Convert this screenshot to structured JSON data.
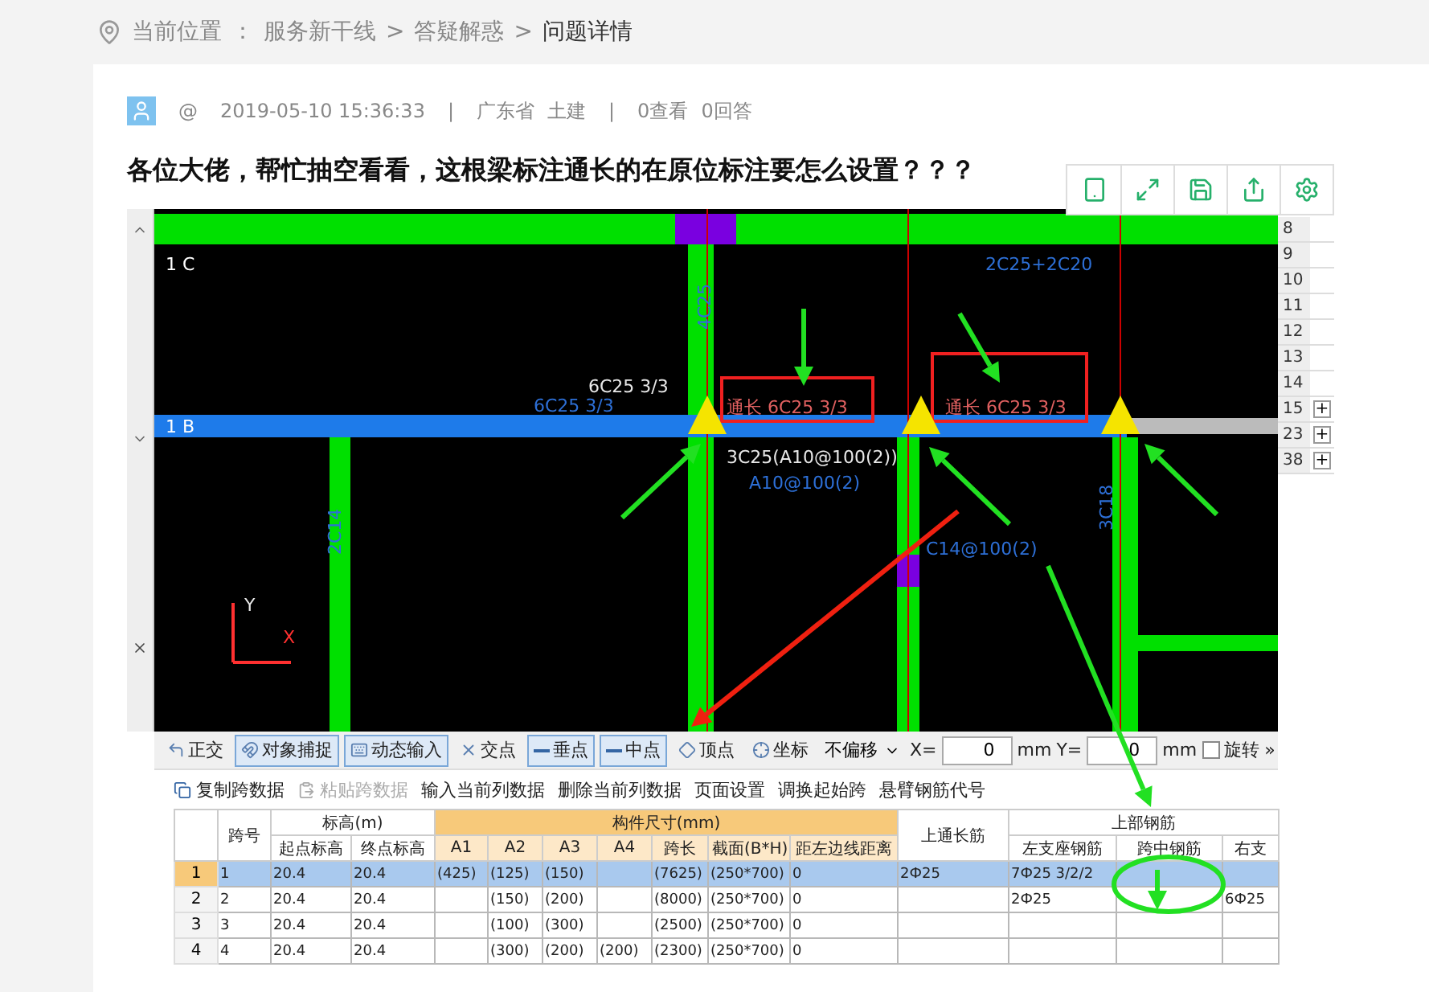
{
  "breadcrumb": {
    "label": "当前位置",
    "colon": "：",
    "path": [
      {
        "text": "服务新干线",
        "current": false
      },
      {
        "text": ">",
        "current": false
      },
      {
        "text": "答疑解惑",
        "current": false
      },
      {
        "text": ">",
        "current": false
      },
      {
        "text": "问题详情",
        "current": true
      }
    ]
  },
  "question": {
    "user": "@",
    "time": "2019-05-10 15:36:33",
    "sep_1": "|",
    "region": "广东省",
    "category": "土建",
    "sep_2": "|",
    "views": "0查看",
    "answers": "0回答",
    "title": "各位大佬，帮忙抽空看看，这根梁标注通长的在原位标注要怎么设置？？？"
  },
  "cad": {
    "labels": [
      {
        "text": "1 C",
        "kind": "axis"
      },
      {
        "text": "1 B",
        "kind": "axis"
      },
      {
        "text": "4C25",
        "kind": "rebar"
      },
      {
        "text": "2C14",
        "kind": "rebar"
      },
      {
        "text": "6C25 3/3",
        "kind": "rebar"
      },
      {
        "text": "6C25 3/3",
        "kind": "note"
      },
      {
        "text": "通长 6C25 3/3",
        "kind": "through"
      },
      {
        "text": "通长 6C25 3/3",
        "kind": "through"
      },
      {
        "text": "3C25(A10@100(2))",
        "kind": "note"
      },
      {
        "text": "A10@100(2)",
        "kind": "rebar"
      },
      {
        "text": "2C25+2C20",
        "kind": "rebar"
      },
      {
        "text": "C14@100(2)",
        "kind": "rebar"
      },
      {
        "text": "3C18",
        "kind": "rebar"
      },
      {
        "text": "Y",
        "kind": "note"
      },
      {
        "text": "X",
        "kind": "coord"
      }
    ]
  },
  "row_panel": [
    {
      "number": "8"
    },
    {
      "number": "9"
    },
    {
      "number": "10"
    },
    {
      "number": "11"
    },
    {
      "number": "12"
    },
    {
      "number": "13"
    },
    {
      "number": "14"
    },
    {
      "number": "15",
      "expand": "+"
    },
    {
      "number": "23",
      "expand": "+"
    },
    {
      "number": "38",
      "expand": "+"
    }
  ],
  "toolbar": {
    "tools": [
      {
        "label": "正交",
        "selected": false
      },
      {
        "label": "对象捕捉",
        "selected": true
      },
      {
        "label": "动态输入",
        "selected": true
      },
      {
        "label": "交点",
        "selected": false
      },
      {
        "label": "垂点",
        "selected": true
      },
      {
        "label": "中点",
        "selected": true
      },
      {
        "label": "顶点",
        "selected": false
      },
      {
        "label": "坐标",
        "selected": false
      }
    ],
    "offset": "不偏移",
    "x_label": "X=",
    "x_value": "0",
    "x_unit": "mm",
    "y_label": "Y=",
    "y_value": "0",
    "y_unit": "mm",
    "rotate": {
      "label": "旋转",
      "checked": false
    },
    "more": "»"
  },
  "actions": [
    {
      "label": "复制跨数据",
      "disabled": false
    },
    {
      "label": "粘贴跨数据",
      "disabled": true
    },
    {
      "label": "输入当前列数据",
      "disabled": false
    },
    {
      "label": "删除当前列数据",
      "disabled": false
    },
    {
      "label": "页面设置",
      "disabled": false
    },
    {
      "label": "调换起始跨",
      "disabled": false
    },
    {
      "label": "悬臂钢筋代号",
      "disabled": false
    }
  ],
  "table": {
    "headers": [
      {
        "label": "跨号"
      },
      {
        "label": "标高(m)",
        "highlighted": false,
        "columns": [
          "起点标高",
          "终点标高"
        ]
      },
      {
        "label": "构件尺寸(mm)",
        "highlighted": true,
        "columns": [
          "A1",
          "A2",
          "A3",
          "A4",
          "跨长",
          "截面(B*H)",
          "距左边线距离"
        ]
      },
      {
        "label": "上通长筋"
      },
      {
        "label": "上部钢筋",
        "highlighted": false,
        "columns": [
          "左支座钢筋",
          "跨中钢筋",
          "右支"
        ]
      }
    ],
    "rows": [
      {
        "number": "1",
        "selected": true,
        "cells": [
          "1",
          "20.4",
          "20.4",
          "(425)",
          "(125)",
          "(150)",
          "",
          "(7625)",
          "(250*700)",
          "0",
          "2Ф25",
          "7Ф25 3/2/2",
          "",
          ""
        ]
      },
      {
        "number": "2",
        "selected": false,
        "cells": [
          "2",
          "20.4",
          "20.4",
          "",
          "(150)",
          "(200)",
          "",
          "(8000)",
          "(250*700)",
          "0",
          "",
          "2Ф25",
          "",
          "6Ф25"
        ]
      },
      {
        "number": "3",
        "selected": false,
        "cells": [
          "3",
          "20.4",
          "20.4",
          "",
          "(100)",
          "(300)",
          "",
          "(2500)",
          "(250*700)",
          "0",
          "",
          "",
          "",
          ""
        ]
      },
      {
        "number": "4",
        "selected": false,
        "cells": [
          "4",
          "20.4",
          "20.4",
          "",
          "(300)",
          "(200)",
          "(200)",
          "(2300)",
          "(250*700)",
          "0",
          "",
          "",
          "",
          ""
        ]
      }
    ]
  }
}
